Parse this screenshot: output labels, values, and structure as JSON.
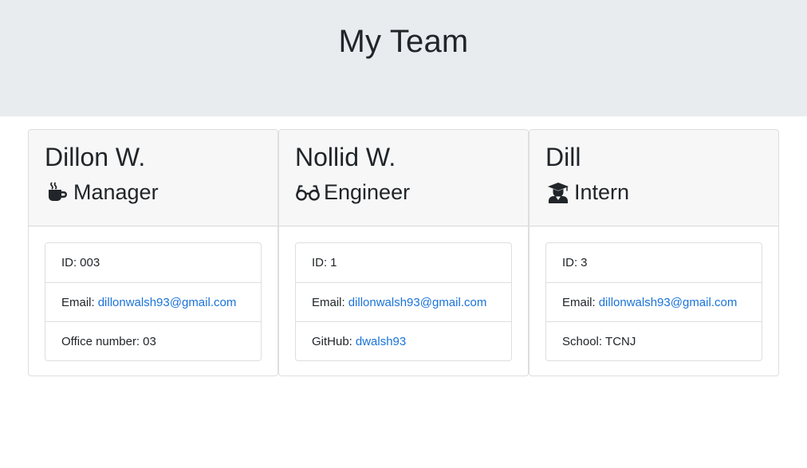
{
  "header": {
    "title": "My Team"
  },
  "cards": [
    {
      "name": "Dillon W.",
      "role": "Manager",
      "role_icon": "mug-icon",
      "id_label": "ID:",
      "id_value": "003",
      "email_label": "Email:",
      "email_value": "dillonwalsh93@gmail.com",
      "extra_label": "Office number:",
      "extra_value": "03"
    },
    {
      "name": "Nollid W.",
      "role": "Engineer",
      "role_icon": "glasses-icon",
      "id_label": "ID:",
      "id_value": "1",
      "email_label": "Email:",
      "email_value": "dillonwalsh93@gmail.com",
      "extra_label": "GitHub:",
      "extra_value": "dwalsh93"
    },
    {
      "name": "Dill",
      "role": "Intern",
      "role_icon": "graduate-icon",
      "id_label": "ID:",
      "id_value": "3",
      "email_label": "Email:",
      "email_value": "dillonwalsh93@gmail.com",
      "extra_label": "School:",
      "extra_value": "TCNJ"
    }
  ],
  "colors": {
    "jumbotron": "#e9ecef",
    "link": "#1a73d9",
    "header_bg": "#f7f7f7"
  }
}
